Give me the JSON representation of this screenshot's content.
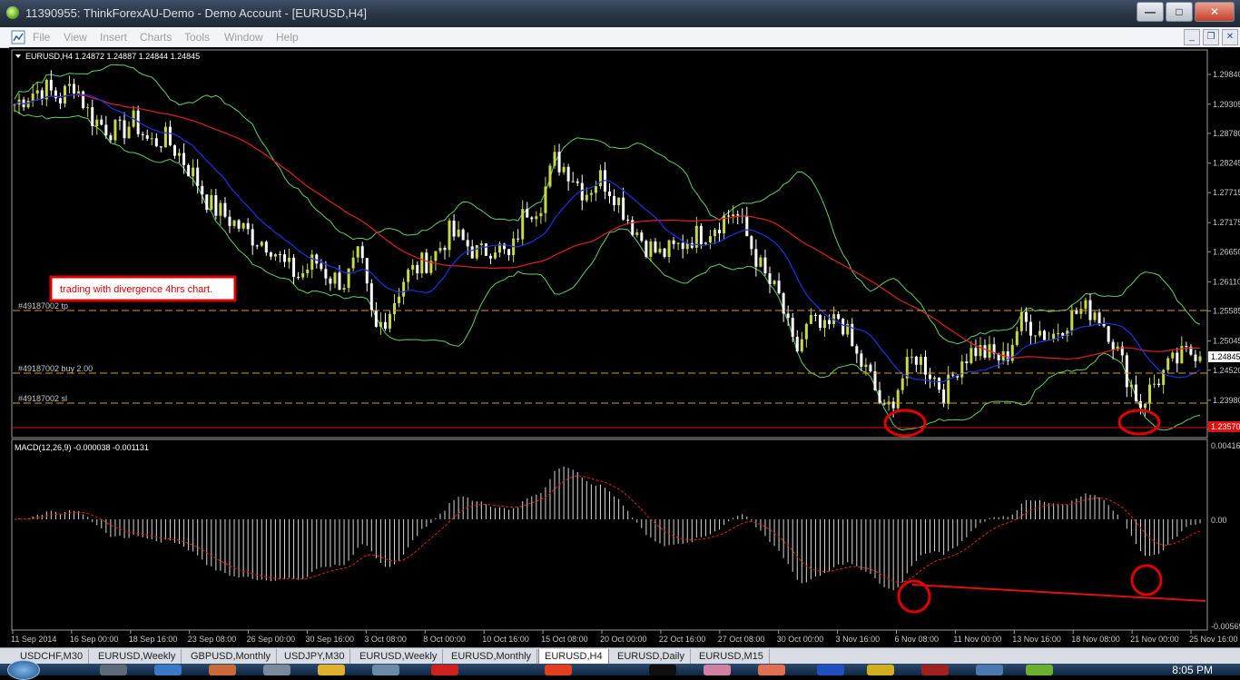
{
  "window": {
    "title": "11390955: ThinkForexAU-Demo - Demo Account - [EURUSD,H4]"
  },
  "menu": [
    "File",
    "View",
    "Insert",
    "Charts",
    "Tools",
    "Window",
    "Help"
  ],
  "chart": {
    "header": "EURUSD,H4  1.24872 1.24887 1.24844 1.24845",
    "annotation": "trading with divergence 4hrs chart.",
    "order_lines": {
      "tp": "#49187002 tp",
      "buy": "#49187002 buy 2.00",
      "sl": "#49187002 sl"
    },
    "current_price": "1.24845",
    "red_level_label": "1.23570",
    "macd_header": "MACD(12,26,9) -0.000038 -0.001131",
    "macd_scale": [
      "0.00416",
      "0.00",
      "-0.00569"
    ]
  },
  "chart_data": {
    "type": "candlestick",
    "symbol": "EURUSD",
    "timeframe": "H4",
    "price_axis_ticks": [
      "1.29840",
      "1.29305",
      "1.28780",
      "1.28245",
      "1.27715",
      "1.27175",
      "1.26650",
      "1.26110",
      "1.25585",
      "1.25045",
      "1.24520",
      "1.23980",
      "1.23455"
    ],
    "time_axis_ticks": [
      "11 Sep 2014",
      "16 Sep 00:00",
      "18 Sep 16:00",
      "23 Sep 08:00",
      "26 Sep 00:00",
      "30 Sep 16:00",
      "3 Oct 08:00",
      "8 Oct 00:00",
      "10 Oct 16:00",
      "15 Oct 08:00",
      "20 Oct 00:00",
      "22 Oct 16:00",
      "27 Oct 08:00",
      "30 Oct 00:00",
      "3 Nov 16:00",
      "6 Nov 08:00",
      "11 Nov 00:00",
      "13 Nov 16:00",
      "18 Nov 08:00",
      "21 Nov 00:00",
      "25 Nov 16:00"
    ],
    "levels": {
      "tp": 1.2574,
      "buy": 1.2457,
      "sl": 1.2403,
      "red": 1.2357
    },
    "close_path": [
      1.293,
      1.295,
      1.296,
      1.294,
      1.297,
      1.291,
      1.289,
      1.288,
      1.29,
      1.286,
      1.287,
      1.284,
      1.28,
      1.275,
      1.273,
      1.271,
      1.269,
      1.268,
      1.264,
      1.262,
      1.265,
      1.262,
      1.261,
      1.266,
      1.252,
      1.256,
      1.262,
      1.264,
      1.266,
      1.27,
      1.268,
      1.266,
      1.268,
      1.265,
      1.274,
      1.275,
      1.283,
      1.281,
      1.277,
      1.28,
      1.277,
      1.272,
      1.268,
      1.266,
      1.267,
      1.269,
      1.27,
      1.272,
      1.274,
      1.268,
      1.262,
      1.258,
      1.248,
      1.254,
      1.252,
      1.255,
      1.248,
      1.244,
      1.237,
      1.243,
      1.248,
      1.245,
      1.241,
      1.247,
      1.249,
      1.248,
      1.247,
      1.254,
      1.253,
      1.251,
      1.254,
      1.256,
      1.256,
      1.252,
      1.245,
      1.239,
      1.243,
      1.246,
      1.248,
      1.249
    ]
  },
  "tabs": [
    "USDCHF,M30",
    "EURUSD,Weekly",
    "GBPUSD,Monthly",
    "USDJPY,M30",
    "EURUSD,Weekly",
    "EURUSD,Monthly",
    "EURUSD,H4",
    "EURUSD,Daily",
    "EURUSD,M15"
  ],
  "active_tab": "EURUSD,H4",
  "taskbar": {
    "clock": "8:05 PM"
  },
  "colors": {
    "bull_candle": "#c8d84a",
    "bear_candle": "#ffffff",
    "ma_red": "#e02020",
    "ma_blue": "#2030e0",
    "bollinger": "#5fd06a",
    "order_line": "#d4a020",
    "annotation_red": "#e00000"
  }
}
